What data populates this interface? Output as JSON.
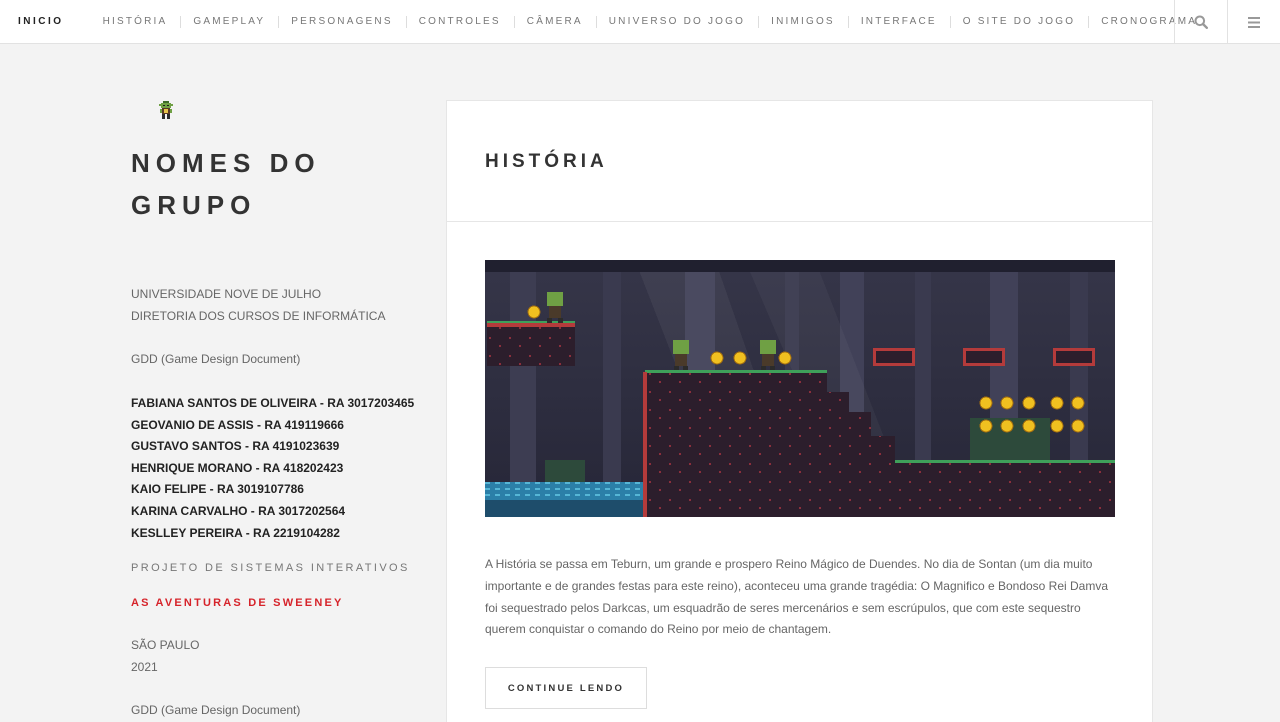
{
  "nav": {
    "home": "INICIO",
    "items": [
      "HISTÓRIA",
      "GAMEPLAY",
      "PERSONAGENS",
      "CONTROLES",
      "CÂMERA",
      "UNIVERSO DO JOGO",
      "INIMIGOS",
      "INTERFACE",
      "O SITE DO JOGO",
      "CRONOGRAMA"
    ],
    "search_icon": "search-icon",
    "menu_icon": "menu-icon"
  },
  "sidebar": {
    "logo_icon": "goblin-logo-icon",
    "title_line1": "NOMES DO",
    "title_line2": "GRUPO",
    "university": "UNIVERSIDADE NOVE DE JULHO",
    "department": "DIRETORIA DOS CURSOS DE INFORMÁTICA",
    "gdd_1": "GDD (Game Design Document)",
    "members": [
      "FABIANA SANTOS DE OLIVEIRA - RA 3017203465",
      "GEOVANIO DE ASSIS - RA 419119666",
      "GUSTAVO SANTOS - RA 4191023639",
      "HENRIQUE MORANO - RA 418202423",
      "KAIO FELIPE - RA 3019107786",
      "KARINA CARVALHO - RA 3017202564",
      "KESLLEY PEREIRA - RA 2219104282"
    ],
    "project": "PROJETO DE SISTEMAS INTERATIVOS",
    "game_name": "AS AVENTURAS DE SWEENEY",
    "city": "SÃO PAULO",
    "year": "2021",
    "gdd_2": "GDD (Game Design Document)"
  },
  "post": {
    "title": "HISTÓRIA",
    "excerpt": "A História se passa em Teburn, um grande e prospero Reino Mágico de Duendes. No dia de Sontan (um dia muito importante e de grandes festas para este reino), aconteceu uma grande tragédia: O Magnifico e Bondoso Rei Damva foi sequestrado pelos Darkcas, um esquadrão de seres mercenários e sem escrúpulos, que com este sequestro querem conquistar o comando do Reino por meio de chantagem.",
    "read_more": "CONTINUE LENDO"
  },
  "colors": {
    "accent_red": "#d6232a",
    "background": "#f3f3f3"
  }
}
